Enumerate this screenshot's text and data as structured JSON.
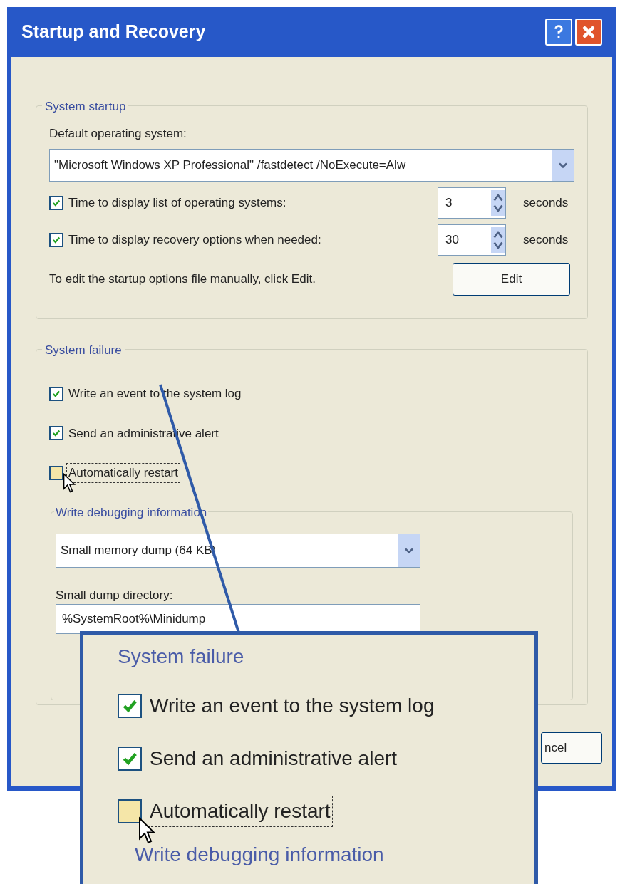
{
  "window": {
    "title": "Startup and Recovery"
  },
  "system_startup": {
    "title": "System startup",
    "default_os_label": "Default operating system:",
    "default_os_value": "\"Microsoft Windows XP Professional\" /fastdetect /NoExecute=Alw",
    "timeouts": [
      {
        "label": "Time to display list of operating systems:",
        "checked": true,
        "value": "3",
        "unit": "seconds"
      },
      {
        "label": "Time to display recovery options when needed:",
        "checked": true,
        "value": "30",
        "unit": "seconds"
      }
    ],
    "edit_hint": "To edit the startup options file manually, click Edit.",
    "edit_button": "Edit"
  },
  "system_failure": {
    "title": "System failure",
    "options": [
      {
        "label": "Write an event to the system log",
        "checked": true,
        "focused": false
      },
      {
        "label": "Send an administrative alert",
        "checked": true,
        "focused": false
      },
      {
        "label": "Automatically restart",
        "checked": false,
        "focused": true
      }
    ],
    "debugging": {
      "title": "Write debugging information",
      "dump_type": "Small memory dump (64 KB)",
      "dump_dir_label": "Small dump directory:",
      "dump_dir_value": "%SystemRoot%\\Minidump"
    }
  },
  "footer_buttons": [
    "ncel"
  ],
  "callout": {
    "title": "System failure",
    "options": [
      {
        "label": "Write an event to the system log",
        "checked": true,
        "focused": false
      },
      {
        "label": "Send an administrative alert",
        "checked": true,
        "focused": false
      },
      {
        "label": "Automatically restart",
        "checked": false,
        "focused": true
      }
    ],
    "debugging_title": "Write debugging information"
  }
}
